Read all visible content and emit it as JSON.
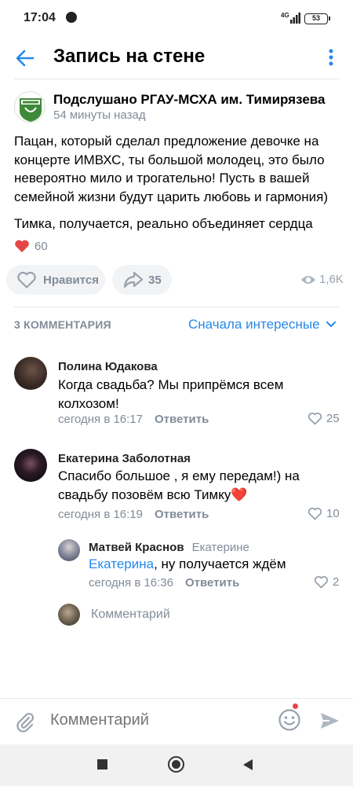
{
  "status_bar": {
    "time": "17:04",
    "network": "4G",
    "battery": "53"
  },
  "header": {
    "title": "Запись на стене"
  },
  "post": {
    "author": "Подслушано РГАУ-МСХА им. Тимирязева",
    "time": "54 минуты назад",
    "text": "Пацан, который сделал предложение девочке на концерте ИМВХС, ты большой молодец, это было невероятно мило и трогательно! Пусть в вашей семейной жизни будут царить любовь и гармония)",
    "text2": "Тимка, получается, реально объединяет сердца",
    "reactions_count": "60",
    "like_label": "Нравится",
    "share_count": "35",
    "views": "1,6K"
  },
  "comments_section": {
    "count_label": "3 КОММЕНТАРИЯ",
    "sort_label": "Сначала интересные",
    "comments": [
      {
        "author": "Полина Юдакова",
        "text": "Когда свадьба? Мы припрёмся всем колхозом!",
        "time": "сегодня в 16:17",
        "reply_label": "Ответить",
        "likes": "25"
      },
      {
        "author": "Екатерина Заболотная",
        "text": "Спасибо большое , я ему передам!) на свадьбу позовём всю Тимку",
        "emoji": "❤️",
        "time": "сегодня в 16:19",
        "reply_label": "Ответить",
        "likes": "10"
      }
    ],
    "reply": {
      "author": "Матвей Краснов",
      "reply_to": "Екатерине",
      "mention": "Екатерина",
      "text": ", ну получается ждём",
      "time": "сегодня в 16:36",
      "reply_label": "Ответить",
      "likes": "2"
    },
    "add_comment_label": "Комментарий"
  },
  "composer": {
    "placeholder": "Комментарий"
  },
  "colors": {
    "accent": "#2688eb",
    "secondary_text": "#818c99",
    "heart": "#e64646",
    "pill_bg": "#f2f3f5"
  },
  "icons": [
    "back-arrow-icon",
    "more-vertical-icon",
    "heart-icon",
    "share-icon",
    "eye-icon",
    "chevron-down-icon",
    "attach-icon",
    "emoji-icon",
    "send-icon"
  ]
}
